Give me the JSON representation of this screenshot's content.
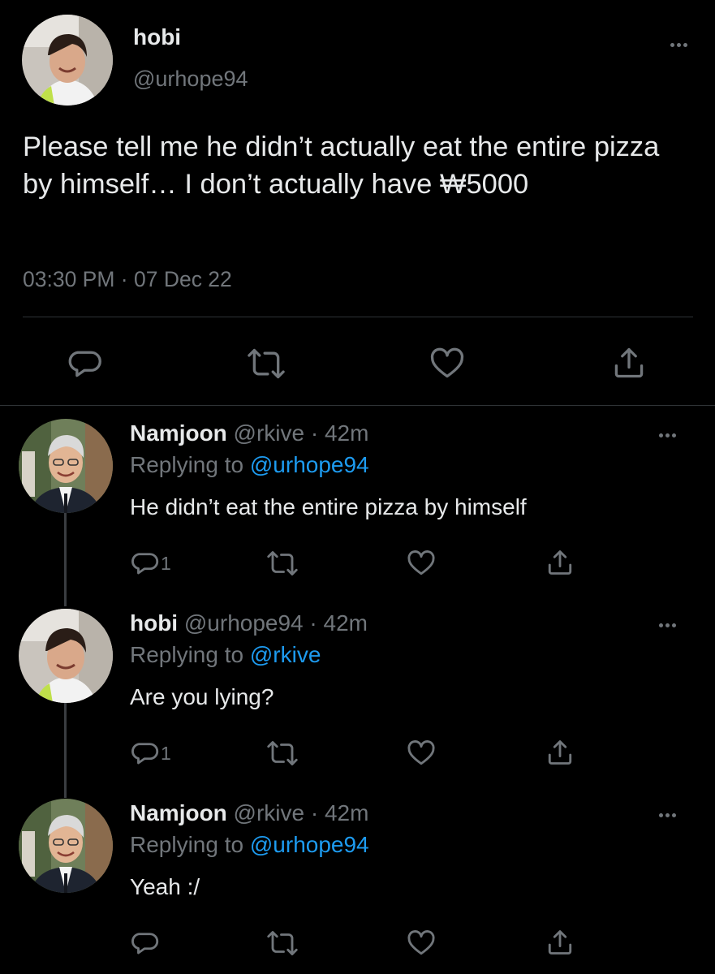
{
  "main_tweet": {
    "name": "hobi",
    "handle": "@urhope94",
    "text": "Please tell me he didn’t actually eat the entire pizza by himself… I don’t actually have ₩5000",
    "timestamp": "03:30 PM · 07 Dec 22"
  },
  "replies": [
    {
      "name": "Namjoon",
      "meta": " @rkive · 42m",
      "replying_prefix": "Replying to ",
      "replying_to": "@urhope94",
      "text": "He didn’t eat the entire pizza by himself",
      "reply_count": "1"
    },
    {
      "name": "hobi",
      "meta": " @urhope94 · 42m",
      "replying_prefix": "Replying to ",
      "replying_to": "@rkive",
      "text": "Are you lying?",
      "reply_count": "1"
    },
    {
      "name": "Namjoon",
      "meta": " @rkive · 42m",
      "replying_prefix": "Replying to ",
      "replying_to": "@urhope94",
      "text": "Yeah :/",
      "reply_count": ""
    }
  ],
  "icons": {
    "reply": "reply-bubble-icon",
    "retweet": "retweet-icon",
    "like": "heart-icon",
    "share": "share-icon",
    "more": "more-dots-icon"
  },
  "colors": {
    "background": "#000000",
    "text_primary": "#e7e9ea",
    "text_secondary": "#71767b",
    "link": "#1d9bf0",
    "divider": "#2f3336"
  }
}
